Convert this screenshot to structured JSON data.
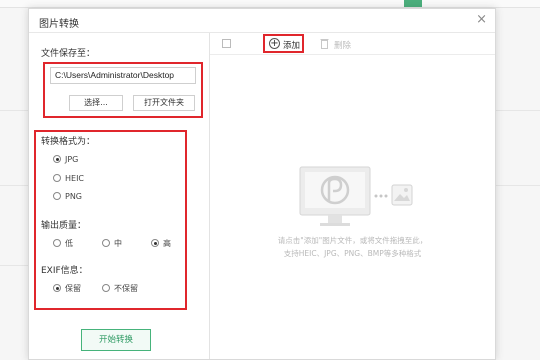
{
  "dialog": {
    "title": "图片转换",
    "close_glyph": "×"
  },
  "save": {
    "label": "文件保存至：",
    "path_value": "C:\\Users\\Administrator\\Desktop",
    "choose_button": "选择...",
    "open_folder_button": "打开文件夹"
  },
  "format": {
    "label": "转换格式为：",
    "options": [
      {
        "label": "JPG",
        "selected": true
      },
      {
        "label": "HEIC",
        "selected": false
      },
      {
        "label": "PNG",
        "selected": false
      }
    ]
  },
  "quality": {
    "label": "输出质量：",
    "options": [
      {
        "label": "低",
        "selected": false
      },
      {
        "label": "中",
        "selected": false
      },
      {
        "label": "高",
        "selected": true
      }
    ]
  },
  "exif": {
    "label": "EXIF信息：",
    "options": [
      {
        "label": "保留",
        "selected": true
      },
      {
        "label": "不保留",
        "selected": false
      }
    ]
  },
  "start_button": "开始转换",
  "toolbar": {
    "add_label": "添加",
    "delete_label": "删除"
  },
  "empty_state": {
    "line1": "请点击\"添加\"图片文件，或将文件拖拽至此，",
    "line2": "支持HEIC、JPG、PNG、BMP等多种格式"
  },
  "colors": {
    "highlight": "#e0262c",
    "accent": "#46b37b"
  }
}
